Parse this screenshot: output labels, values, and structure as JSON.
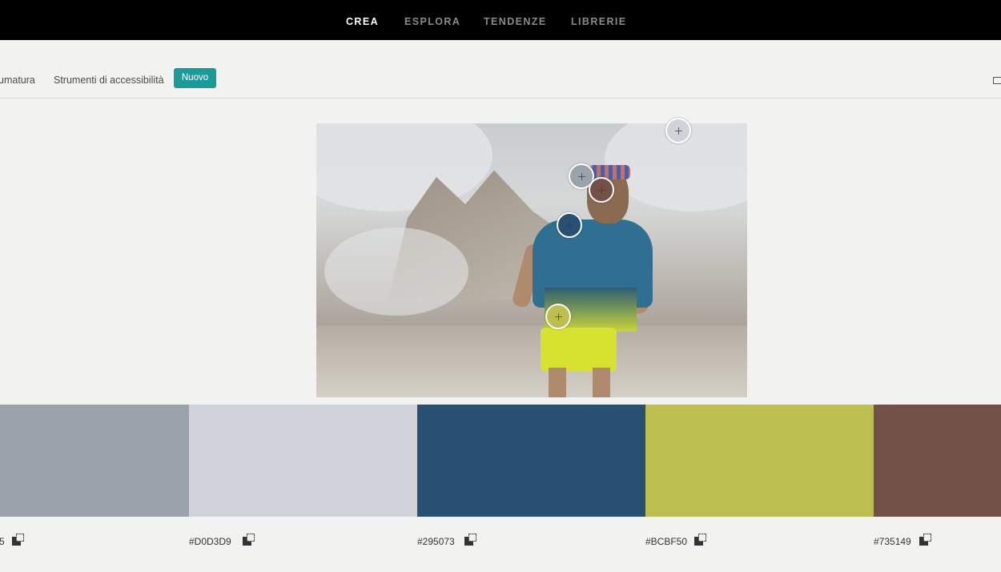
{
  "nav": {
    "items": [
      {
        "label": "CREA",
        "active": true
      },
      {
        "label": "ESPLORA",
        "active": false
      },
      {
        "label": "TENDENZE",
        "active": false
      },
      {
        "label": "LIBRERIE",
        "active": false
      }
    ]
  },
  "subbar": {
    "item_partial": "umatura",
    "accessibility": "Strumenti di accessibilità",
    "badge": "Nuovo"
  },
  "image_alt": "Runner in mountains",
  "swatches": [
    {
      "color": "#9AA2AC",
      "hex": "5"
    },
    {
      "color": "#D0D3D9",
      "hex": "#D0D3D9"
    },
    {
      "color": "#295073",
      "hex": "#295073"
    },
    {
      "color": "#BCBF50",
      "hex": "#BCBF50"
    },
    {
      "color": "#735149",
      "hex": "#735149"
    }
  ],
  "pickers": [
    {
      "color": "#D0D3D9"
    },
    {
      "color": "#9AA2AC"
    },
    {
      "color": "#735149"
    },
    {
      "color": "#295073"
    },
    {
      "color": "#BCBF50"
    }
  ],
  "icons": {
    "copy": "copy-icon",
    "picker": "color-picker-icon",
    "image": "image-icon"
  }
}
